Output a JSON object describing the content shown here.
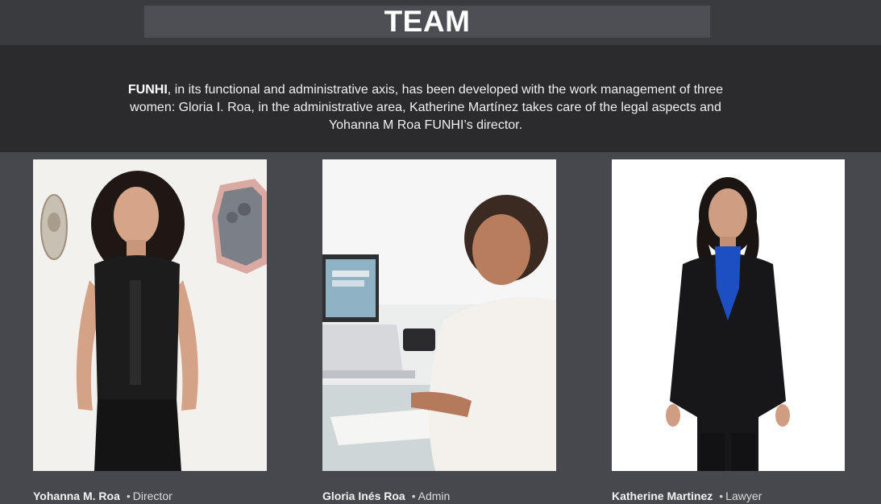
{
  "header": {
    "title": "TEAM"
  },
  "intro": {
    "brand": "FUNHI",
    "text": ", in its functional and administrative axis, has been developed with the work management of three women: Gloria I. Roa, in the administrative area, Katherine Martínez takes care of the legal aspects and Yohanna M Roa FUNHI’s director."
  },
  "team": [
    {
      "name": "Yohanna M. Roa",
      "separator": "•",
      "role": "Director"
    },
    {
      "name": "Gloria Inés Roa",
      "separator": "•",
      "role": "Admin"
    },
    {
      "name": "Katherine Martinez",
      "separator": "•",
      "role": "Lawyer"
    }
  ],
  "colors": {
    "page_bg": "#47484d",
    "top_band": "#3a3b3f",
    "title_box": "#4d4e53",
    "intro_band": "#2b2b2d",
    "text": "#ffffff"
  }
}
